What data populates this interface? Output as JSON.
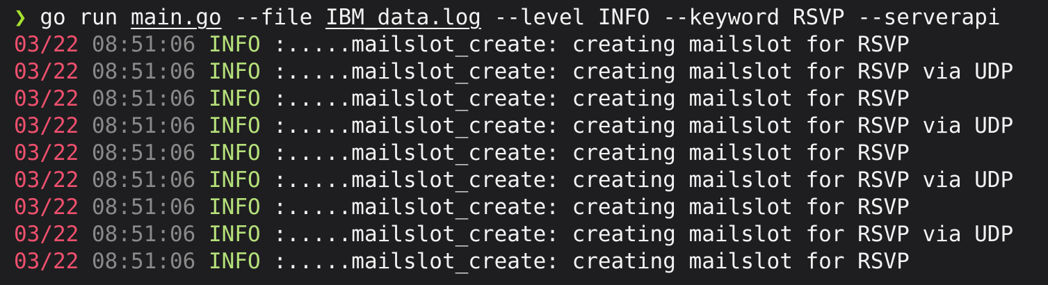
{
  "command": {
    "prompt": "❯",
    "program": "go run",
    "file_arg": "main.go",
    "flag_file": "--file",
    "file_value": "IBM_data.log",
    "rest": "--level INFO --keyword RSVP --serverapi"
  },
  "log_lines": [
    {
      "date": "03/22",
      "time": "08:51:06",
      "level": "INFO",
      "message": ":.....mailslot_create: creating mailslot for RSVP"
    },
    {
      "date": "03/22",
      "time": "08:51:06",
      "level": "INFO",
      "message": ":.....mailslot_create: creating mailslot for RSVP via UDP"
    },
    {
      "date": "03/22",
      "time": "08:51:06",
      "level": "INFO",
      "message": ":.....mailslot_create: creating mailslot for RSVP"
    },
    {
      "date": "03/22",
      "time": "08:51:06",
      "level": "INFO",
      "message": ":.....mailslot_create: creating mailslot for RSVP via UDP"
    },
    {
      "date": "03/22",
      "time": "08:51:06",
      "level": "INFO",
      "message": ":.....mailslot_create: creating mailslot for RSVP"
    },
    {
      "date": "03/22",
      "time": "08:51:06",
      "level": "INFO",
      "message": ":.....mailslot_create: creating mailslot for RSVP via UDP"
    },
    {
      "date": "03/22",
      "time": "08:51:06",
      "level": "INFO",
      "message": ":.....mailslot_create: creating mailslot for RSVP"
    },
    {
      "date": "03/22",
      "time": "08:51:06",
      "level": "INFO",
      "message": ":.....mailslot_create: creating mailslot for RSVP via UDP"
    },
    {
      "date": "03/22",
      "time": "08:51:06",
      "level": "INFO",
      "message": ":.....mailslot_create: creating mailslot for RSVP"
    }
  ],
  "colors": {
    "background": "#1e1e20",
    "prompt": "#a6e22e",
    "date": "#f0506e",
    "time": "#8a8a8a",
    "level": "#b5e07a",
    "text": "#f2f2f2"
  }
}
